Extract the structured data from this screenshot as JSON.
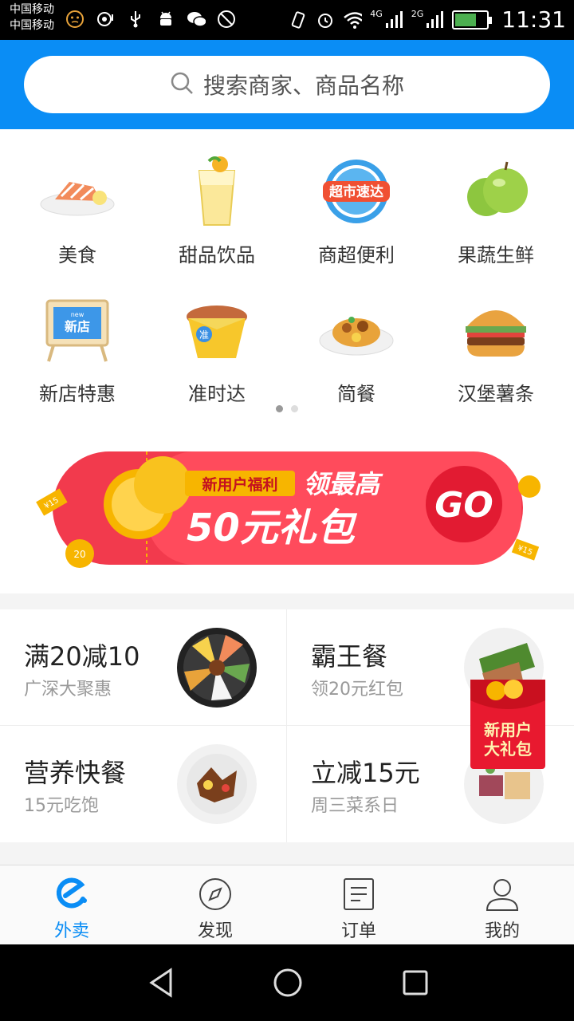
{
  "status_bar": {
    "carrier_1": "中国移动",
    "carrier_2": "中国移动",
    "network_1": "4G",
    "network_2": "2G",
    "time": "11:31"
  },
  "search": {
    "placeholder": "搜索商家、商品名称"
  },
  "categories": [
    {
      "label": "美食",
      "icon": "salmon-dish-icon"
    },
    {
      "label": "甜品饮品",
      "icon": "juice-cup-icon"
    },
    {
      "label": "商超便利",
      "icon": "supermarket-badge-icon"
    },
    {
      "label": "果蔬生鲜",
      "icon": "green-apple-icon"
    },
    {
      "label": "新店特惠",
      "icon": "new-store-sign-icon"
    },
    {
      "label": "准时达",
      "icon": "snack-box-icon"
    },
    {
      "label": "简餐",
      "icon": "rice-plate-icon"
    },
    {
      "label": "汉堡薯条",
      "icon": "burger-icon"
    }
  ],
  "carousel": {
    "pages": 2,
    "active": 0
  },
  "promo_banner": {
    "tag": "新用户福利",
    "headline_1": "领最高",
    "headline_2": "50元礼包",
    "go": "GO",
    "coin_labels": [
      "¥15",
      "20",
      "¥15"
    ]
  },
  "deals": [
    {
      "title": "满20减10",
      "subtitle": "广深大聚惠",
      "icon": "bibimbap-icon"
    },
    {
      "title": "霸王餐",
      "subtitle": "领20元红包",
      "icon": "steak-salad-icon"
    },
    {
      "title": "营养快餐",
      "subtitle": "15元吃饱",
      "icon": "stir-fry-icon"
    },
    {
      "title": "立减15元",
      "subtitle": "周三菜系日",
      "icon": "grill-plate-icon"
    }
  ],
  "red_packet": {
    "line_1": "新用户",
    "line_2": "大礼包"
  },
  "bottom_nav": [
    {
      "label": "外卖",
      "icon": "eleme-logo-icon",
      "active": true
    },
    {
      "label": "发现",
      "icon": "compass-icon",
      "active": false
    },
    {
      "label": "订单",
      "icon": "order-list-icon",
      "active": false
    },
    {
      "label": "我的",
      "icon": "person-icon",
      "active": false
    }
  ],
  "colors": {
    "brand_blue": "#0a8df5",
    "promo_red": "#f23a4d",
    "coin_gold": "#f7b500"
  }
}
